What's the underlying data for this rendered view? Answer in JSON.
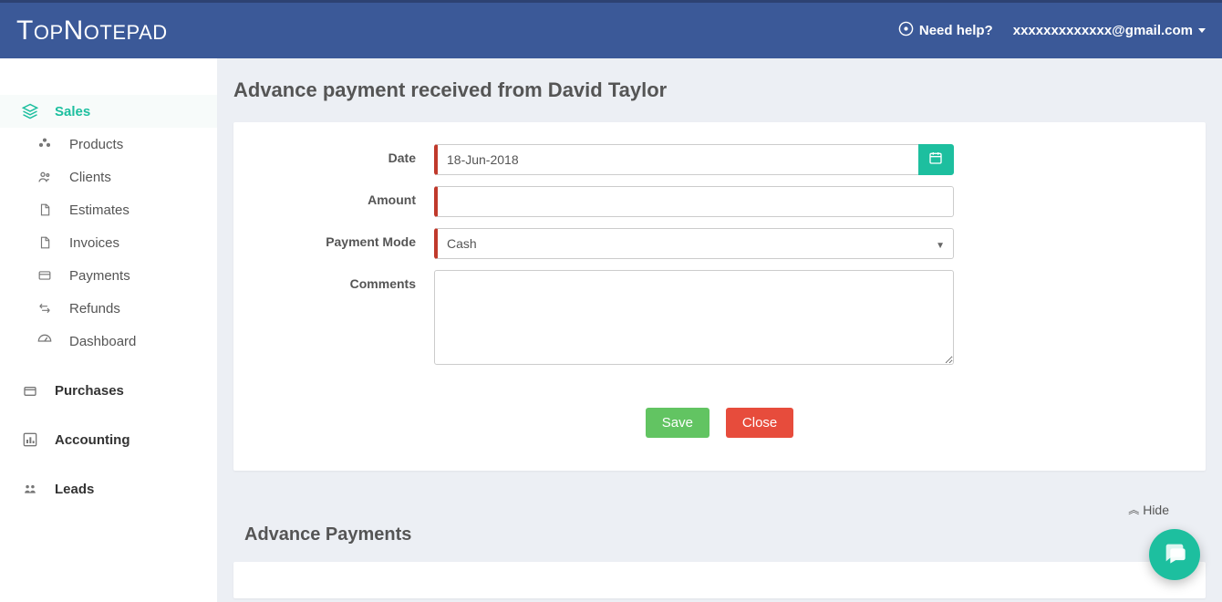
{
  "header": {
    "logo_big1": "T",
    "logo_small1": "op",
    "logo_big2": "N",
    "logo_small2": "otepad",
    "help_label": "Need help?",
    "user_email": "xxxxxxxxxxxxx@gmail.com"
  },
  "sidebar": {
    "sales_label": "Sales",
    "items": [
      {
        "label": "Products"
      },
      {
        "label": "Clients"
      },
      {
        "label": "Estimates"
      },
      {
        "label": "Invoices"
      },
      {
        "label": "Payments"
      },
      {
        "label": "Refunds"
      },
      {
        "label": "Dashboard"
      }
    ],
    "purchases_label": "Purchases",
    "accounting_label": "Accounting",
    "leads_label": "Leads"
  },
  "page": {
    "title": "Advance payment received from David Taylor",
    "labels": {
      "date": "Date",
      "amount": "Amount",
      "payment_mode": "Payment Mode",
      "comments": "Comments"
    },
    "form": {
      "date": "18-Jun-2018",
      "amount": "",
      "payment_mode": "Cash",
      "comments": ""
    },
    "buttons": {
      "save": "Save",
      "close": "Close"
    }
  },
  "lower": {
    "hide_label": "Hide",
    "title": "Advance Payments"
  }
}
